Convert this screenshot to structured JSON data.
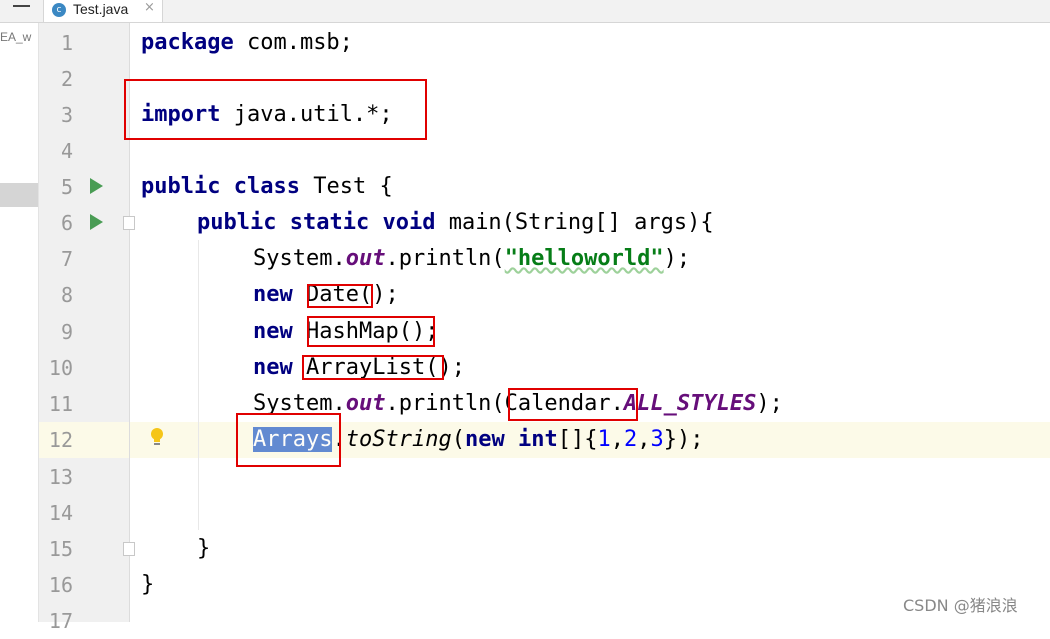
{
  "tab": {
    "icon_letter": "c",
    "filename": "Test.java",
    "close_glyph": "×"
  },
  "project_panel": {
    "item_label": "EA_w"
  },
  "editor": {
    "line_numbers": [
      "1",
      "2",
      "3",
      "4",
      "5",
      "6",
      "7",
      "8",
      "9",
      "10",
      "11",
      "12",
      "13",
      "14",
      "15",
      "16",
      "17"
    ],
    "current_line": "12",
    "lines": {
      "l1": {
        "kw": "package",
        "rest": " com.msb;"
      },
      "l3": {
        "kw": "import",
        "rest": " java.util.*;"
      },
      "l5": {
        "kw1": "public",
        "kw2": "class",
        "rest": " Test {"
      },
      "l6": {
        "kw1": "public",
        "kw2": "static",
        "kw3": "void",
        "rest": " main(String[] args){"
      },
      "l7": {
        "a": "System.",
        "field": "out",
        "b": ".println(",
        "string": "\"helloworld\"",
        "c": ");"
      },
      "l8": {
        "kw": "new",
        "rest": " Date();"
      },
      "l9": {
        "kw": "new",
        "rest": " HashMap();"
      },
      "l10": {
        "kw": "new",
        "rest": " ArrayList();"
      },
      "l11": {
        "a": "System.",
        "field": "out",
        "b": ".println(Calendar.",
        "sfield": "ALL_STYLES",
        "c": ");"
      },
      "l12": {
        "selected": "Arrays",
        "dot": ".",
        "method": "toString",
        "p1": "(",
        "kw1": "new",
        "kw2": "int",
        "p2": "[]{",
        "n1": "1",
        "c1": ",",
        "n2": "2",
        "c2": ",",
        "n3": "3",
        "p3": "});"
      },
      "l15": {
        "rest": "}"
      },
      "l16": {
        "rest": "}"
      }
    }
  },
  "watermark": "CSDN @猪浪浪"
}
